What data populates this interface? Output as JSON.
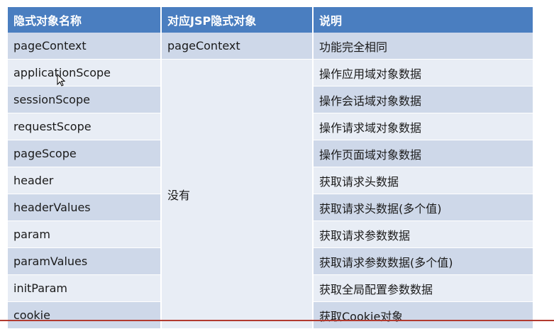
{
  "table": {
    "headers": [
      "隐式对象名称",
      "对应JSP隐式对象",
      "说明"
    ],
    "merged_label": "没有",
    "rows": [
      {
        "name": "pageContext",
        "jsp": "pageContext",
        "desc": "功能完全相同"
      },
      {
        "name": "applicationScope",
        "desc": "操作应用域对象数据"
      },
      {
        "name": "sessionScope",
        "desc": "操作会话域对象数据"
      },
      {
        "name": "requestScope",
        "desc": "操作请求域对象数据"
      },
      {
        "name": "pageScope",
        "desc": "操作页面域对象数据"
      },
      {
        "name": "header",
        "desc": "获取请求头数据"
      },
      {
        "name": "headerValues",
        "desc": "获取请求头数据(多个值)"
      },
      {
        "name": "param",
        "desc": "获取请求参数数据"
      },
      {
        "name": "paramValues",
        "desc": "获取请求参数数据(多个值)"
      },
      {
        "name": "initParam",
        "desc": "获取全局配置参数数据"
      },
      {
        "name": "cookie",
        "desc": "获取Cookie对象"
      }
    ]
  },
  "colors": {
    "header_bg": "#4a7ec0",
    "row_dark": "#ced8e9",
    "row_light": "#e8edf5",
    "bottom_rule": "#b23a2f"
  }
}
